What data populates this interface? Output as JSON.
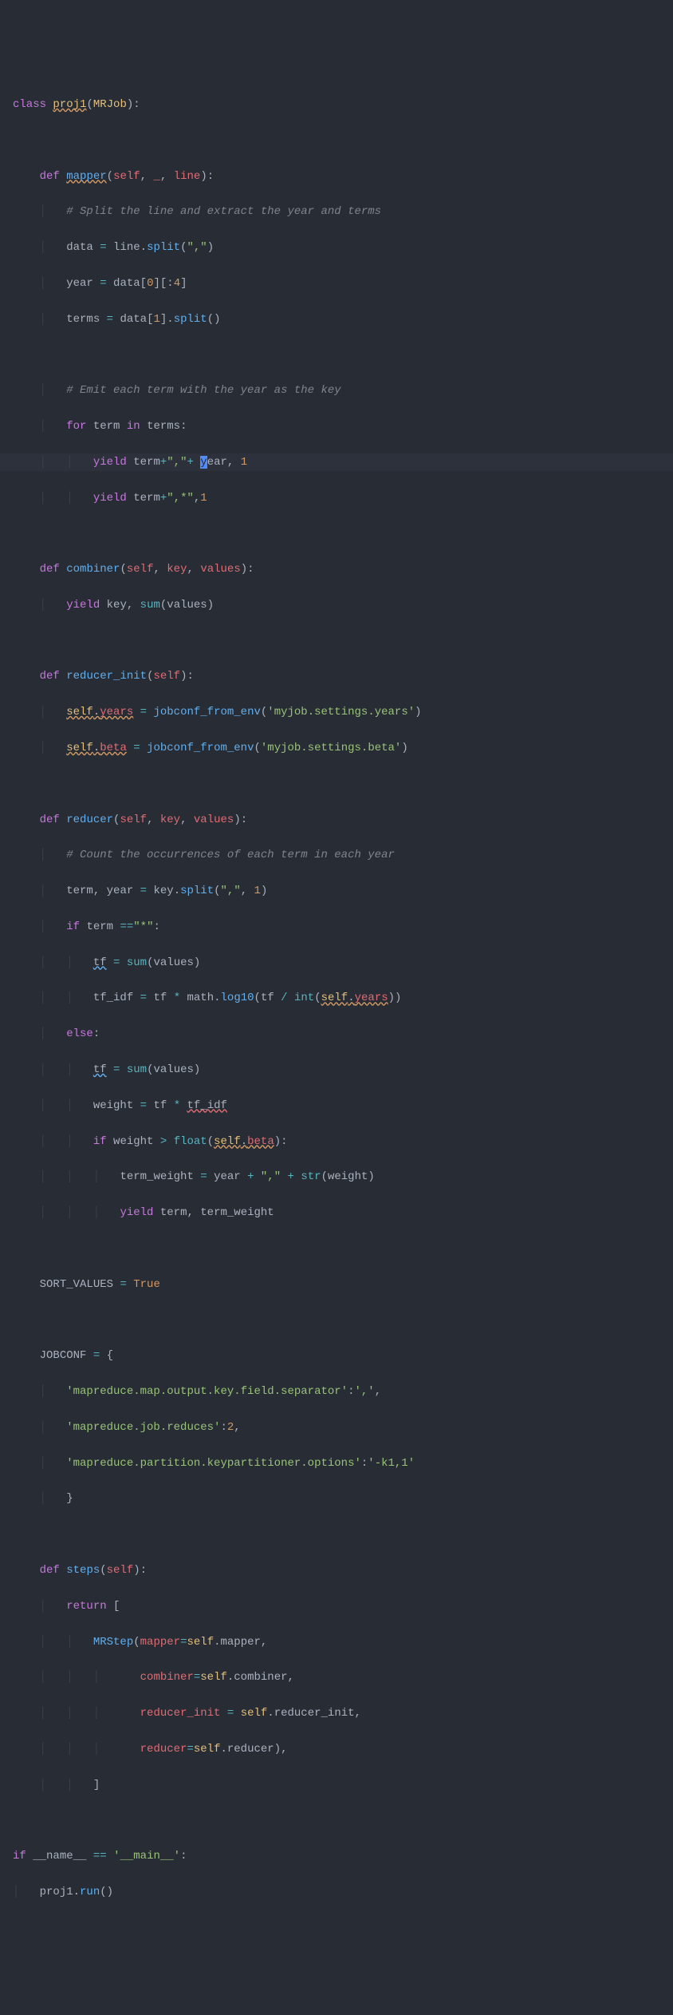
{
  "code": {
    "l1_class": "class",
    "l1_name": "proj1",
    "l1_base": "MRJob",
    "l3_def": "def",
    "l3_name": "mapper",
    "l3_self": "self",
    "l3_p2": "_",
    "l3_p3": "line",
    "l4_comment": "# Split the line and extract the year and terms",
    "l5_data": "data",
    "l5_line": "line",
    "l5_split": "split",
    "l5_arg": "\",\"",
    "l6_year": "year",
    "l6_data": "data",
    "l6_idx0": "0",
    "l6_slice": "4",
    "l7_terms": "terms",
    "l7_data": "data",
    "l7_idx1": "1",
    "l7_split": "split",
    "l9_comment": "# Emit each term with the year as the key",
    "l10_for": "for",
    "l10_term": "term",
    "l10_in": "in",
    "l10_terms": "terms",
    "l11_yield": "yield",
    "l11_term": "term",
    "l11_s1": "\",\"",
    "l11_year": "year",
    "l11_one": "1",
    "l12_yield": "yield",
    "l12_term": "term",
    "l12_s": "\",*\"",
    "l12_one": "1",
    "l14_def": "def",
    "l14_name": "combiner",
    "l14_self": "self",
    "l14_key": "key",
    "l14_values": "values",
    "l15_yield": "yield",
    "l15_key": "key",
    "l15_sum": "sum",
    "l15_values": "values",
    "l17_def": "def",
    "l17_name": "reducer_init",
    "l17_self": "self",
    "l18_self": "self",
    "l18_years": "years",
    "l18_fn": "jobconf_from_env",
    "l18_arg": "'myjob.settings.years'",
    "l19_self": "self",
    "l19_beta": "beta",
    "l19_fn": "jobconf_from_env",
    "l19_arg": "'myjob.settings.beta'",
    "l21_def": "def",
    "l21_name": "reducer",
    "l21_self": "self",
    "l21_key": "key",
    "l21_values": "values",
    "l22_comment": "# Count the occurrences of each term in each year",
    "l23_term": "term",
    "l23_year": "year",
    "l23_key": "key",
    "l23_split": "split",
    "l23_arg1": "\",\"",
    "l23_arg2": "1",
    "l24_if": "if",
    "l24_term": "term",
    "l24_cmp": "\"*\"",
    "l25_tf": "tf",
    "l25_sum": "sum",
    "l25_values": "values",
    "l26_tfidf": "tf_idf",
    "l26_tf": "tf",
    "l26_math": "math",
    "l26_log": "log10",
    "l26_tf2": "tf",
    "l26_int": "int",
    "l26_self": "self",
    "l26_years": "years",
    "l27_else": "else",
    "l28_tf": "tf",
    "l28_sum": "sum",
    "l28_values": "values",
    "l29_weight": "weight",
    "l29_tf": "tf",
    "l29_tfidf": "tf_idf",
    "l30_if": "if",
    "l30_weight": "weight",
    "l30_float": "float",
    "l30_self": "self",
    "l30_beta": "beta",
    "l31_tw": "term_weight",
    "l31_year": "year",
    "l31_s": "\",\"",
    "l31_str": "str",
    "l31_weight": "weight",
    "l32_yield": "yield",
    "l32_term": "term",
    "l32_tw": "term_weight",
    "l34_sv": "SORT_VALUES",
    "l34_true": "True",
    "l36_jc": "JOBCONF",
    "l37_k": "'mapreduce.map.output.key.field.separator'",
    "l37_v": "','",
    "l38_k": "'mapreduce.job.reduces'",
    "l38_v": "2",
    "l39_k": "'mapreduce.partition.keypartitioner.options'",
    "l39_v": "'-k1,1'",
    "l42_def": "def",
    "l42_name": "steps",
    "l42_self": "self",
    "l43_return": "return",
    "l44_mrstep": "MRStep",
    "l44_mapper": "mapper",
    "l44_self": "self",
    "l44_m": "mapper",
    "l45_combiner": "combiner",
    "l45_self": "self",
    "l45_c": "combiner",
    "l46_ri": "reducer_init",
    "l46_self": "self",
    "l46_r": "reducer_init",
    "l47_reducer": "reducer",
    "l47_self": "self",
    "l47_r": "reducer",
    "l50_if": "if",
    "l50_name": "__name__",
    "l50_main": "'__main__'",
    "l51_proj": "proj1",
    "l51_run": "run"
  }
}
